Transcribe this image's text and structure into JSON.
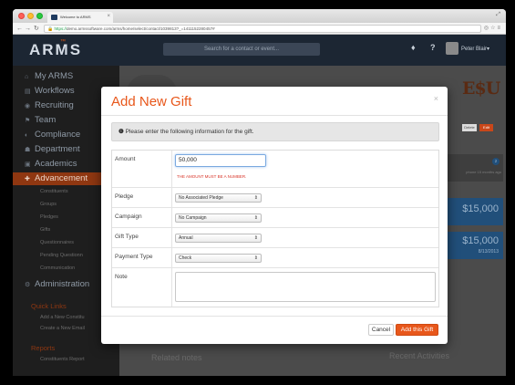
{
  "browser": {
    "tab_title": "Welcome to ARMS",
    "url_https": "https://",
    "url_rest": "demo.armssoftware.com/arms/home/select/contact/1039813?_=1411152280457#"
  },
  "header": {
    "logo": "ARMS",
    "logo_superscript": "™",
    "search_placeholder": "Search for a contact or event...",
    "user_name": "Peter Blair▾"
  },
  "sidebar": {
    "items": [
      {
        "label": "My ARMS",
        "icon": "home-icon"
      },
      {
        "label": "Workflows",
        "icon": "workflow-icon"
      },
      {
        "label": "Recruiting",
        "icon": "target-icon"
      },
      {
        "label": "Team",
        "icon": "team-icon"
      },
      {
        "label": "Compliance",
        "icon": "shield-icon"
      },
      {
        "label": "Department",
        "icon": "department-icon"
      },
      {
        "label": "Academics",
        "icon": "book-icon"
      },
      {
        "label": "Advancement",
        "icon": "advancement-icon"
      }
    ],
    "sub_items": [
      "Constituents",
      "Groups",
      "Pledges",
      "Gifts",
      "Questionnaires",
      "Pending Questionn",
      "Communication"
    ],
    "administration": "Administration",
    "quick_links_title": "Quick Links",
    "quick_links": [
      "Add a New Constitu",
      "Create a New Email"
    ],
    "reports_title": "Reports",
    "reports": [
      "Constituents Report"
    ]
  },
  "background": {
    "delete_label": "Delete",
    "edit_label": "Edit",
    "badge_count": "2",
    "activity_note": "phone 15 months ago",
    "amount_1": "$15,000",
    "amount_2": "$15,000",
    "date_2": "8/13/2013",
    "recent_activities": "Recent Activities",
    "related_label": "Related notes"
  },
  "modal": {
    "title": "Add New Gift",
    "close": "×",
    "alert_icon": "❶",
    "alert_text": "Please enter the following information for the gift.",
    "fields": {
      "amount_label": "Amount",
      "amount_value": "50,000",
      "amount_error": "THE AMOUNT MUST BE A NUMBER.",
      "pledge_label": "Pledge",
      "pledge_value": "No Associated Pledge",
      "campaign_label": "Campaign",
      "campaign_value": "No Campaign",
      "gift_type_label": "Gift Type",
      "gift_type_value": "Annual",
      "payment_type_label": "Payment Type",
      "payment_type_value": "Check",
      "note_label": "Note",
      "note_value": ""
    },
    "cancel_label": "Cancel",
    "submit_label": "Add this Gift"
  },
  "colors": {
    "accent": "#e8571b",
    "nav_bg": "#1c2633",
    "error": "#d9362a"
  }
}
